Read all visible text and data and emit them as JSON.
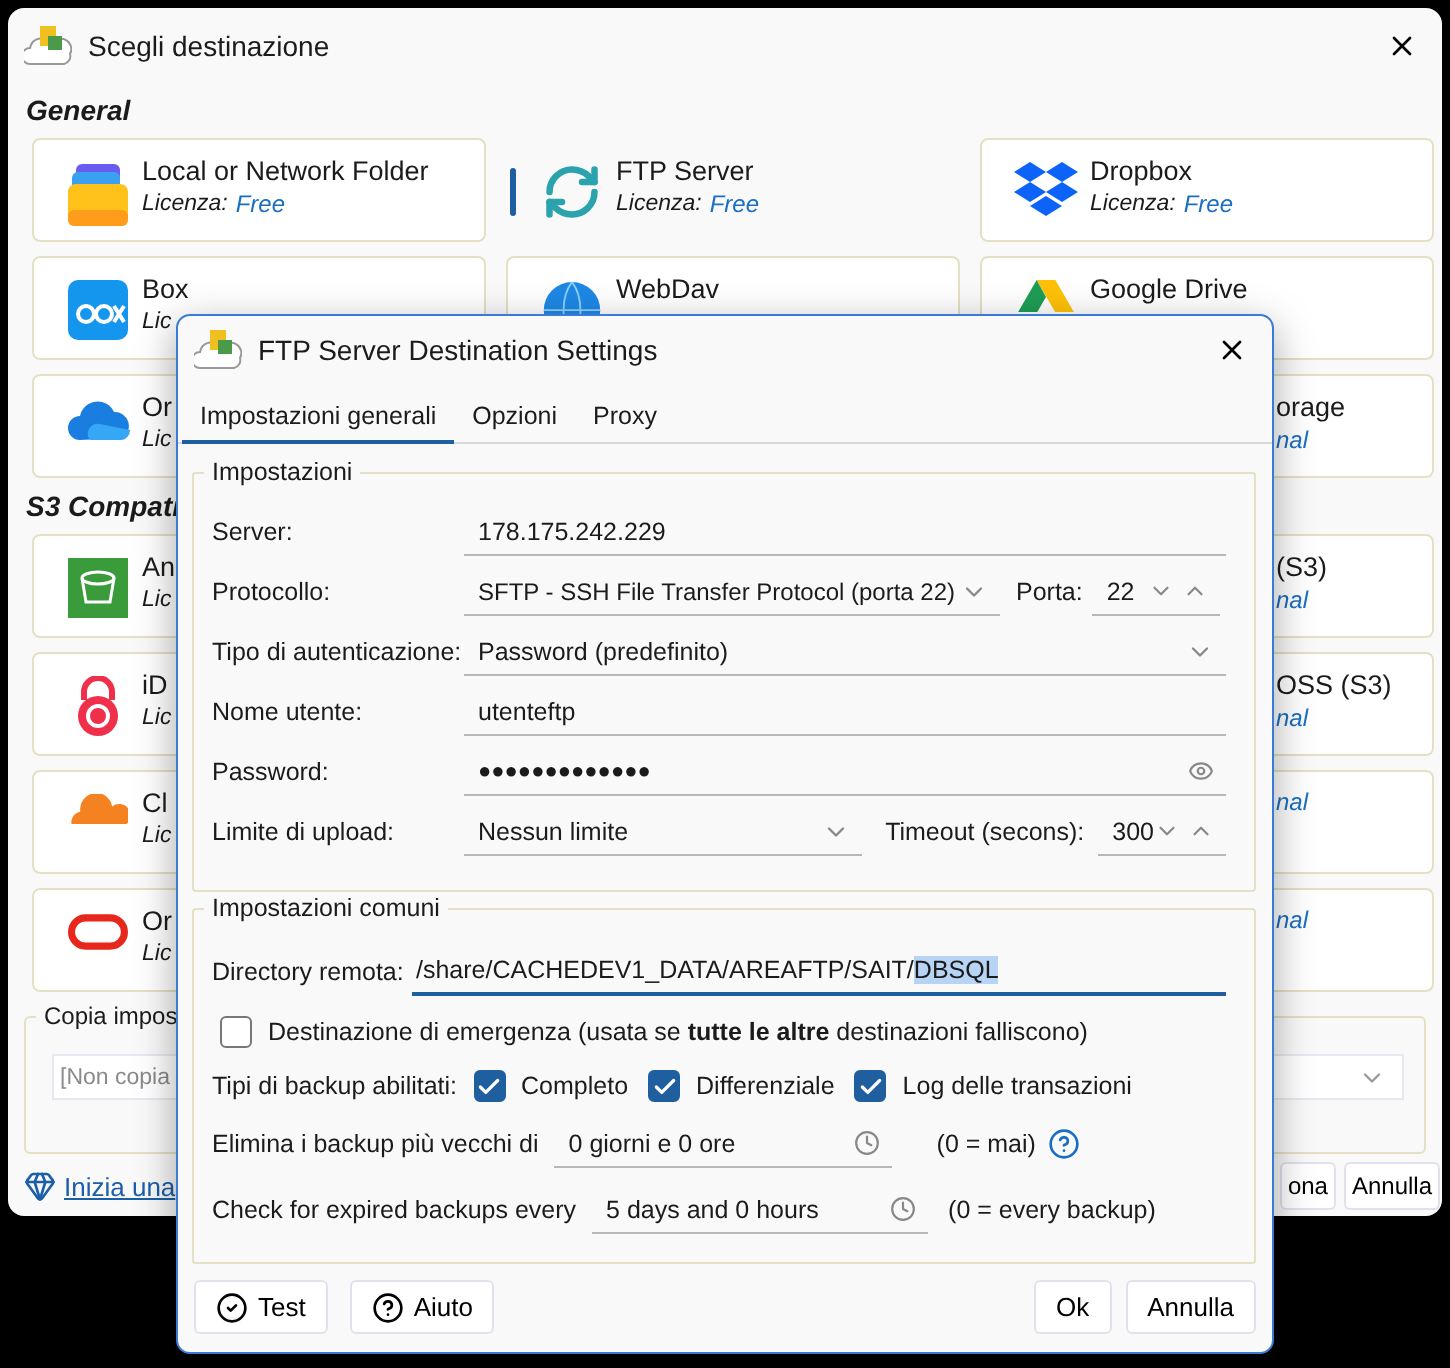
{
  "main_window": {
    "title": "Scegli destinazione",
    "sections": [
      {
        "heading": "General",
        "rows": [
          {
            "left": {
              "title": "Local or Network Folder",
              "license": "Licenza:",
              "license_value": "Free",
              "selected": false
            },
            "middle": {
              "title": "FTP Server",
              "license": "Licenza:",
              "license_value": "Free",
              "selected": true
            },
            "right": {
              "title": "Dropbox",
              "license": "Licenza:",
              "license_value": "Free",
              "selected": false
            }
          },
          {
            "left": {
              "title": "Box",
              "license": "Lic",
              "selected": false
            },
            "middle": {
              "title": "WebDav",
              "selected": false
            },
            "right": {
              "title": "Google Drive",
              "selected": false
            }
          },
          {
            "left": {
              "title": "Or",
              "license": "Lic",
              "selected": false
            },
            "right": {
              "kind": "clipped",
              "title": "orage",
              "license_value": "nal",
              "selected": false
            }
          }
        ]
      },
      {
        "heading": "S3 Compati",
        "rows": [
          {
            "left": {
              "title": "An",
              "license": "Lic",
              "selected": false
            },
            "right": {
              "kind": "clipped",
              "title": "(S3)",
              "license_value": "nal",
              "selected": false
            }
          },
          {
            "left": {
              "title": "iD",
              "license": "Lic",
              "selected": false
            },
            "right": {
              "kind": "clipped",
              "title": "OSS (S3)",
              "license_value": "nal",
              "selected": false
            }
          },
          {
            "left": {
              "title": "Cl",
              "license": "Lic",
              "selected": false
            },
            "right": {
              "kind": "clipped",
              "license_value": "nal",
              "selected": false
            }
          },
          {
            "left": {
              "title": "Or",
              "license": "Lic",
              "selected": false
            },
            "right": {
              "kind": "clipped",
              "license_value": "nal",
              "selected": false
            }
          }
        ]
      }
    ],
    "copy_group": {
      "legend": "Copia impos",
      "dropdown": "[Non copia"
    },
    "link": "Inizia una",
    "buttons": [
      "ona",
      "Annulla"
    ]
  },
  "dialog": {
    "title": "FTP Server Destination Settings",
    "tabs": [
      {
        "label": "Impostazioni generali",
        "selected": true
      },
      {
        "label": "Opzioni",
        "selected": false
      },
      {
        "label": "Proxy",
        "selected": false
      }
    ],
    "settings": {
      "legend": "Impostazioni",
      "server": {
        "label": "Server:",
        "value": "178.175.242.229"
      },
      "protocol": {
        "label": "Protocollo:",
        "value": "SFTP - SSH File Transfer Protocol (porta 22)",
        "port_label": "Porta:",
        "port": "22"
      },
      "auth": {
        "label": "Tipo di autenticazione:",
        "value": "Password (predefinito)"
      },
      "user": {
        "label": "Nome utente:",
        "value": "utenteftp"
      },
      "password": {
        "label": "Password:",
        "value": "●●●●●●●●●●●●●"
      },
      "upload": {
        "label": "Limite di upload:",
        "value": "Nessun limite",
        "timeout_label": "Timeout (secons):",
        "timeout": "300"
      }
    },
    "common": {
      "legend": "Impostazioni comuni",
      "directory": {
        "label": "Directory remota:",
        "value": "/share/CACHEDEV1_DATA/AREAFTP/SAIT/",
        "selected_text": "DBSQL"
      },
      "emergency": {
        "label": "Destinazione di emergenza (usata se **tutte le altre** destinazioni falliscono)",
        "checked": false
      },
      "backup_types": {
        "label": "Tipi di backup abilitati:",
        "options": [
          {
            "label": "Completo",
            "checked": true
          },
          {
            "label": "Differenziale",
            "checked": true
          },
          {
            "label": "Log delle transazioni",
            "checked": true
          }
        ]
      },
      "delete_older": {
        "label": "Elimina i backup più vecchi di",
        "value": "0 giorni e 0 ore",
        "note": "(0 = mai)"
      },
      "check_expired": {
        "label": "Check for expired backups every",
        "value": "5 days and 0 hours",
        "note": "(0 = every backup)"
      }
    },
    "left_buttons": [
      "Test",
      "Aiuto"
    ],
    "right_buttons": [
      "Ok",
      "Annulla"
    ]
  }
}
